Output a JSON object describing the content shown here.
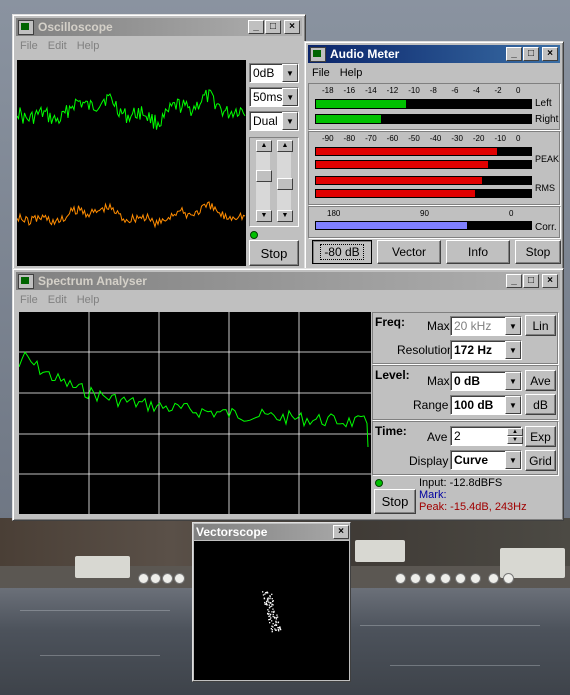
{
  "oscilloscope": {
    "title": "Oscilloscope",
    "menu": [
      "File",
      "Edit",
      "Help"
    ],
    "gain": "0dB",
    "timebase": "50ms",
    "mode": "Dual",
    "stop_label": "Stop",
    "colors": {
      "left_trace": "#00ff00",
      "right_trace": "#ff8c00",
      "screen": "#000000"
    }
  },
  "audio_meter": {
    "title": "Audio Meter",
    "menu": [
      "File",
      "Help"
    ],
    "top_scale": [
      "-18",
      "-16",
      "-14",
      "-12",
      "-10",
      "-8",
      "-6",
      "-4",
      "-2",
      "0"
    ],
    "lr_labels": {
      "left": "Left",
      "right": "Right"
    },
    "left_level": 0.42,
    "right_level": 0.3,
    "db_scale": [
      "-90",
      "-80",
      "-70",
      "-60",
      "-50",
      "-40",
      "-30",
      "-20",
      "-10",
      "0"
    ],
    "peak_label": "PEAK",
    "rms_label": "RMS",
    "peak_levels": [
      0.84,
      0.8
    ],
    "rms_levels": [
      0.77,
      0.74
    ],
    "corr_scale": [
      "180",
      "90",
      "0"
    ],
    "corr_label": "Corr.",
    "corr_level": 0.7,
    "buttons": {
      "range": "-80 dB",
      "vector": "Vector",
      "info": "Info",
      "stop": "Stop"
    }
  },
  "spectrum": {
    "title": "Spectrum Analyser",
    "menu": [
      "File",
      "Edit",
      "Help"
    ],
    "freq": {
      "heading": "Freq:",
      "max_label": "Max",
      "max_value": "20 kHz",
      "lin_button": "Lin",
      "res_label": "Resolution",
      "res_value": "172 Hz"
    },
    "level": {
      "heading": "Level:",
      "max_label": "Max",
      "max_value": "0 dB",
      "ave_button": "Ave",
      "range_label": "Range",
      "range_value": "100 dB",
      "db_button": "dB"
    },
    "time": {
      "heading": "Time:",
      "ave_label": "Ave",
      "ave_value": "2",
      "exp_button": "Exp",
      "display_label": "Display",
      "display_value": "Curve",
      "grid_button": "Grid"
    },
    "stop_label": "Stop",
    "readout": {
      "input": "Input: -12.8dBFS",
      "mark": "Mark:",
      "peak": "Peak: -15.4dB, 243Hz"
    },
    "colors": {
      "curve": "#00ff00",
      "grid": "#ffffff",
      "mark": "#0000a0",
      "peak": "#a00000"
    }
  },
  "vectorscope": {
    "title": "Vectorscope"
  }
}
